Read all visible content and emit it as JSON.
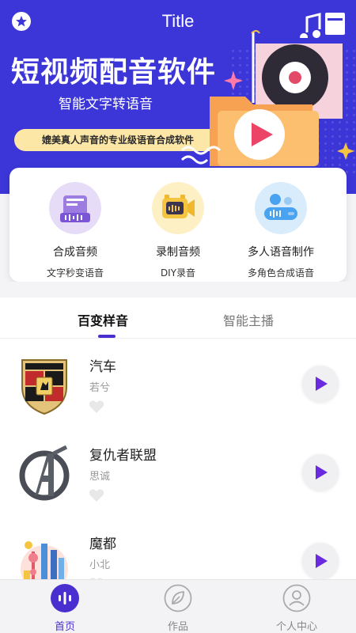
{
  "header": {
    "title": "Title",
    "headline": "短视频配音软件",
    "subheadline": "智能文字转语音",
    "tagline": "媲美真人声音的专业级语音合成软件"
  },
  "features": [
    {
      "label": "合成音频",
      "desc": "文字秒变语音",
      "icon": "audio-synthesis-icon"
    },
    {
      "label": "录制音频",
      "desc": "DIY录音",
      "icon": "video-recorder-icon"
    },
    {
      "label": "多人语音制作",
      "desc": "多角色合成语音",
      "icon": "multi-voice-icon"
    }
  ],
  "tabs": [
    {
      "label": "百变样音",
      "active": true
    },
    {
      "label": "智能主播",
      "active": false
    }
  ],
  "list": [
    {
      "title": "汽车",
      "author": "若兮",
      "thumb": "porsche-logo-image"
    },
    {
      "title": "复仇者联盟",
      "author": "思诚",
      "thumb": "avengers-logo-image"
    },
    {
      "title": "魔都",
      "author": "小北",
      "thumb": "shanghai-skyline-image"
    }
  ],
  "bottom_nav": [
    {
      "label": "首页",
      "icon": "home-voice-icon",
      "active": true
    },
    {
      "label": "作品",
      "icon": "leaf-icon",
      "active": false
    },
    {
      "label": "个人中心",
      "icon": "user-icon",
      "active": false
    }
  ],
  "colors": {
    "primary": "#3c36d8",
    "accent": "#4a2fd0",
    "pill": "#fde7a7",
    "play_icon": "#6a2be0"
  }
}
